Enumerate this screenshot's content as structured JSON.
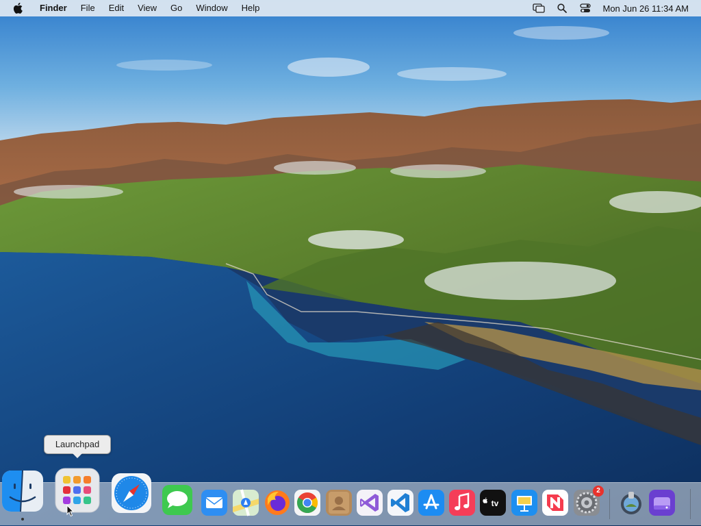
{
  "menubar": {
    "app_name": "Finder",
    "menus": [
      "File",
      "Edit",
      "View",
      "Go",
      "Window",
      "Help"
    ],
    "clock": "Mon Jun 26  11:34 AM",
    "status_icons": [
      "screen-mirroring-icon",
      "spotlight-search-icon",
      "control-center-icon"
    ]
  },
  "tooltip": {
    "text": "Launchpad"
  },
  "dock": {
    "items": [
      {
        "name": "Finder",
        "icon": "finder-icon",
        "running": true
      },
      {
        "name": "Launchpad",
        "icon": "launchpad-icon",
        "running": false
      },
      {
        "name": "Safari",
        "icon": "safari-icon",
        "running": false
      },
      {
        "name": "Messages",
        "icon": "messages-icon",
        "running": false
      },
      {
        "name": "Mail",
        "icon": "mail-icon",
        "running": false
      },
      {
        "name": "Maps",
        "icon": "maps-icon",
        "running": false
      },
      {
        "name": "Firefox",
        "icon": "firefox-icon",
        "running": false
      },
      {
        "name": "Google Chrome",
        "icon": "chrome-icon",
        "running": false
      },
      {
        "name": "Contacts",
        "icon": "contacts-icon",
        "running": false
      },
      {
        "name": "Visual Studio",
        "icon": "visual-studio-icon",
        "running": false
      },
      {
        "name": "Visual Studio Code",
        "icon": "vscode-icon",
        "running": false
      },
      {
        "name": "App Store",
        "icon": "app-store-icon",
        "running": false
      },
      {
        "name": "Music",
        "icon": "music-icon",
        "running": false
      },
      {
        "name": "TV",
        "icon": "apple-tv-icon",
        "label": "tv",
        "running": false
      },
      {
        "name": "Keynote",
        "icon": "keynote-icon",
        "running": false
      },
      {
        "name": "News",
        "icon": "news-icon",
        "running": false
      },
      {
        "name": "System Preferences",
        "icon": "system-preferences-icon",
        "badge": "2",
        "running": false
      },
      {
        "name": "Simulator",
        "icon": "simulator-icon",
        "running": false
      },
      {
        "name": "Disk Utility",
        "icon": "disk-utility-icon",
        "running": false
      }
    ]
  },
  "colors": {
    "menubar_bg": "#e1e9f2",
    "badge": "#e8322c",
    "sky": "#3d8fd6",
    "ocean": "#184a86"
  }
}
